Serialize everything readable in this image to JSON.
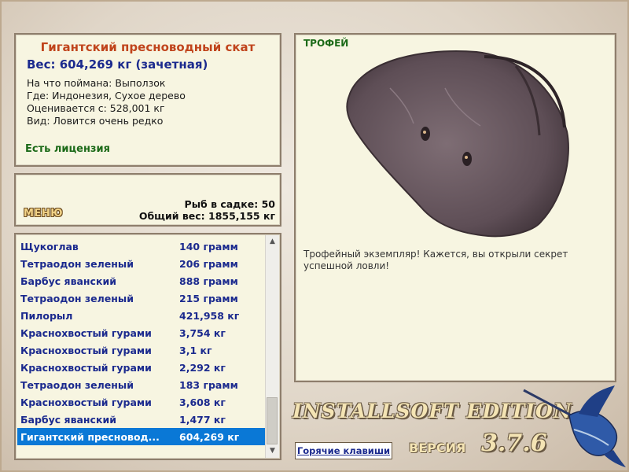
{
  "fish": {
    "title": "Гигантский пресноводный скат",
    "weight": "Вес: 604,269 кг (зачетная)",
    "bait": "На что поймана: Выползок",
    "place": "Где: Индонезия, Сухое дерево",
    "valued": "Оценивается с: 528,001 кг",
    "kind": "Вид: Ловится очень редко",
    "license": "Есть лицензия"
  },
  "stats": {
    "menu_label": "МЕНЮ",
    "count": "Рыб в садке: 50",
    "total": "Общий вес: 1855,155 кг"
  },
  "catch_list": [
    {
      "name": "Щукоглав",
      "weight": "140 грамм"
    },
    {
      "name": "Тетраодон зеленый",
      "weight": "206 грамм"
    },
    {
      "name": "Барбус яванский",
      "weight": "888 грамм"
    },
    {
      "name": "Тетраодон зеленый",
      "weight": "215 грамм"
    },
    {
      "name": "Пилорыл",
      "weight": "421,958 кг"
    },
    {
      "name": "Краснохвостый гурами",
      "weight": "3,754 кг"
    },
    {
      "name": "Краснохвостый гурами",
      "weight": "3,1 кг"
    },
    {
      "name": "Краснохвостый гурами",
      "weight": "2,292 кг"
    },
    {
      "name": "Тетраодон зеленый",
      "weight": "183 грамм"
    },
    {
      "name": "Краснохвостый гурами",
      "weight": "3,608 кг"
    },
    {
      "name": "Барбус яванский",
      "weight": "1,477 кг"
    },
    {
      "name": "Гигантский пресновод...",
      "weight": "604,269 кг",
      "selected": true
    }
  ],
  "trophy": {
    "label": "ТРОФЕЙ",
    "description": "Трофейный экземпляр! Кажется, вы открыли секрет успешной ловли!"
  },
  "brand": {
    "edition": "INSTALLSOFT EDITION",
    "version_label": "ВЕРСИЯ",
    "version": "3.7.6",
    "hotkeys": "Горячие клавиши"
  },
  "colors": {
    "title": "#c0441c",
    "accent_blue": "#1b2a8e",
    "license_green": "#1c6a18",
    "selection": "#0a78d6"
  }
}
